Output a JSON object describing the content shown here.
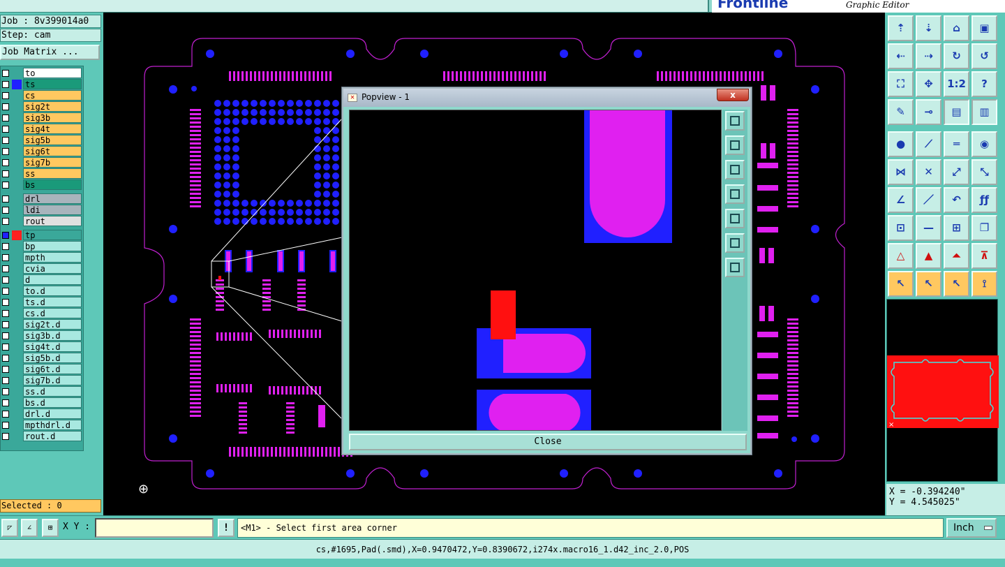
{
  "brand": {
    "logo": "Frontline",
    "subtitle": "Graphic Editor"
  },
  "job": {
    "job_label": "Job : 8v399014a0",
    "step_label": "Step: cam",
    "matrix_button": "Job Matrix ..."
  },
  "layers": [
    {
      "name": "to",
      "color": "#ffffff",
      "swatch": ""
    },
    {
      "name": "ts",
      "color": "#1a9a7a",
      "swatch": "#2020ff"
    },
    {
      "name": "cs",
      "color": "#ffc860",
      "swatch": ""
    },
    {
      "name": "sig2t",
      "color": "#ffc860",
      "swatch": ""
    },
    {
      "name": "sig3b",
      "color": "#ffc860",
      "swatch": ""
    },
    {
      "name": "sig4t",
      "color": "#ffc860",
      "swatch": ""
    },
    {
      "name": "sig5b",
      "color": "#ffc860",
      "swatch": ""
    },
    {
      "name": "sig6t",
      "color": "#ffc860",
      "swatch": ""
    },
    {
      "name": "sig7b",
      "color": "#ffc860",
      "swatch": ""
    },
    {
      "name": "ss",
      "color": "#ffc860",
      "swatch": ""
    },
    {
      "name": "bs",
      "color": "#1a9a7a",
      "swatch": ""
    },
    {
      "name": "drl",
      "color": "#a8b4bc",
      "swatch": ""
    },
    {
      "name": "ldi",
      "color": "#a8b4bc",
      "swatch": ""
    },
    {
      "name": "rout",
      "color": "#e0e0e0",
      "swatch": ""
    },
    {
      "name": "tp",
      "color": "#3aa89a",
      "swatch": "#ff2020"
    },
    {
      "name": "bp",
      "color": "#a8e8e0",
      "swatch": ""
    },
    {
      "name": "mpth",
      "color": "#a8e8e0",
      "swatch": ""
    },
    {
      "name": "cvia",
      "color": "#a8e8e0",
      "swatch": ""
    },
    {
      "name": "d",
      "color": "#a8e8e0",
      "swatch": ""
    },
    {
      "name": "to.d",
      "color": "#a8e8e0",
      "swatch": ""
    },
    {
      "name": "ts.d",
      "color": "#a8e8e0",
      "swatch": ""
    },
    {
      "name": "cs.d",
      "color": "#a8e8e0",
      "swatch": ""
    },
    {
      "name": "sig2t.d",
      "color": "#a8e8e0",
      "swatch": ""
    },
    {
      "name": "sig3b.d",
      "color": "#a8e8e0",
      "swatch": ""
    },
    {
      "name": "sig4t.d",
      "color": "#a8e8e0",
      "swatch": ""
    },
    {
      "name": "sig5b.d",
      "color": "#a8e8e0",
      "swatch": ""
    },
    {
      "name": "sig6t.d",
      "color": "#a8e8e0",
      "swatch": ""
    },
    {
      "name": "sig7b.d",
      "color": "#a8e8e0",
      "swatch": ""
    },
    {
      "name": "ss.d",
      "color": "#a8e8e0",
      "swatch": ""
    },
    {
      "name": "bs.d",
      "color": "#a8e8e0",
      "swatch": ""
    },
    {
      "name": "drl.d",
      "color": "#a8e8e0",
      "swatch": ""
    },
    {
      "name": "mpthdrl.d",
      "color": "#a8e8e0",
      "swatch": ""
    },
    {
      "name": "rout.d",
      "color": "#a8e8e0",
      "swatch": ""
    }
  ],
  "selected_label": "Selected : 0",
  "popview": {
    "title": "Popview - 1",
    "close_x": "x",
    "close_button": "Close"
  },
  "coords": {
    "x_readout": "X = -0.394240\"",
    "y_readout": "Y = 4.545025\""
  },
  "command": {
    "xy_label": "X Y :",
    "xy_value": "",
    "prompt": "<M1> - Select first area corner",
    "units": "Inch"
  },
  "status": "cs,#1695,Pad(.smd),X=0.9470472,Y=0.8390672,i274x.macro16_1.d42_inc_2.0,POS",
  "colors": {
    "pad_magenta": "#e020f0",
    "pad_blue": "#2020ff",
    "highlight_red": "#ff1010",
    "outline": "#c020d0",
    "panel_teal": "#5ec8b8"
  },
  "toolbar_icons": [
    "home-in-icon",
    "home-out-icon",
    "home-icon",
    "window-icon",
    "pan-left-icon",
    "pan-right-icon",
    "flip-icon",
    "redraw-icon",
    "fit-icon",
    "center-icon",
    "ratio-icon",
    "help-icon",
    "tools-icon",
    "measure-icon",
    "layers-red-icon",
    "layers-blue-icon",
    "select-pad-icon",
    "cross-select-icon",
    "ruler-icon",
    "pad-dot-icon",
    "net-icon",
    "cross-icon",
    "snap-red-icon",
    "snap-line-icon",
    "angle-icon",
    "line-icon",
    "arc-icon",
    "fit-text-icon",
    "point-icon",
    "minus-icon",
    "dimension-icon",
    "copy-icon",
    "triangle-red-icon",
    "triangle-icon",
    "triangle-base-icon",
    "triangle-cross-icon",
    "pointer-icon",
    "pointer-box-icon",
    "pointer-alt-icon",
    "net-pointer-icon"
  ],
  "toolbar_labels": [
    "1:2",
    "?"
  ]
}
